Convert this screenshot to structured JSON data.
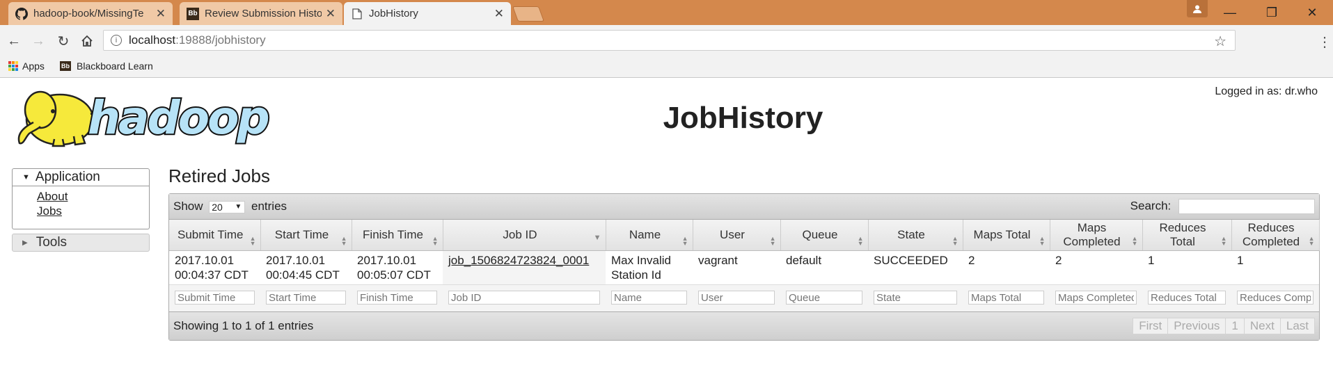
{
  "browser": {
    "tabs": [
      {
        "title": "hadoop-book/MissingTe",
        "icon": "github-icon"
      },
      {
        "title": "Review Submission Histo",
        "icon": "blackboard-icon"
      },
      {
        "title": "JobHistory",
        "icon": "page-icon"
      }
    ],
    "url_host": "localhost",
    "url_path": ":19888/jobhistory",
    "bookmarks": [
      {
        "label": "Apps",
        "icon": "apps-grid-icon"
      },
      {
        "label": "Blackboard Learn",
        "icon": "blackboard-icon",
        "icon_text": "Bb"
      }
    ]
  },
  "header": {
    "logo_text": "hadoop",
    "title": "JobHistory",
    "logged_in": "Logged in as: dr.who"
  },
  "sidebar": {
    "application_label": "Application",
    "links": [
      "About",
      "Jobs"
    ],
    "tools_label": "Tools"
  },
  "main": {
    "section_title": "Retired Jobs",
    "show_label": "Show",
    "page_length": "20",
    "entries_label": "entries",
    "search_label": "Search:",
    "columns": [
      "Submit Time",
      "Start Time",
      "Finish Time",
      "Job ID",
      "Name",
      "User",
      "Queue",
      "State",
      "Maps Total",
      "Maps Completed",
      "Reduces Total",
      "Reduces Completed"
    ],
    "rows": [
      {
        "submit_time": "2017.10.01 00:04:37 CDT",
        "start_time": "2017.10.01 00:04:45 CDT",
        "finish_time": "2017.10.01 00:05:07 CDT",
        "job_id": "job_1506824723824_0001",
        "name": "Max Invalid Station Id",
        "user": "vagrant",
        "queue": "default",
        "state": "SUCCEEDED",
        "maps_total": "2",
        "maps_completed": "2",
        "reduces_total": "1",
        "reduces_completed": "1"
      }
    ],
    "filters": [
      "Submit Time",
      "Start Time",
      "Finish Time",
      "Job ID",
      "Name",
      "User",
      "Queue",
      "State",
      "Maps Total",
      "Maps Completed",
      "Reduces Total",
      "Reduces Completed"
    ],
    "info": "Showing 1 to 1 of 1 entries",
    "pager": {
      "first": "First",
      "previous": "Previous",
      "page": "1",
      "next": "Next",
      "last": "Last"
    }
  }
}
